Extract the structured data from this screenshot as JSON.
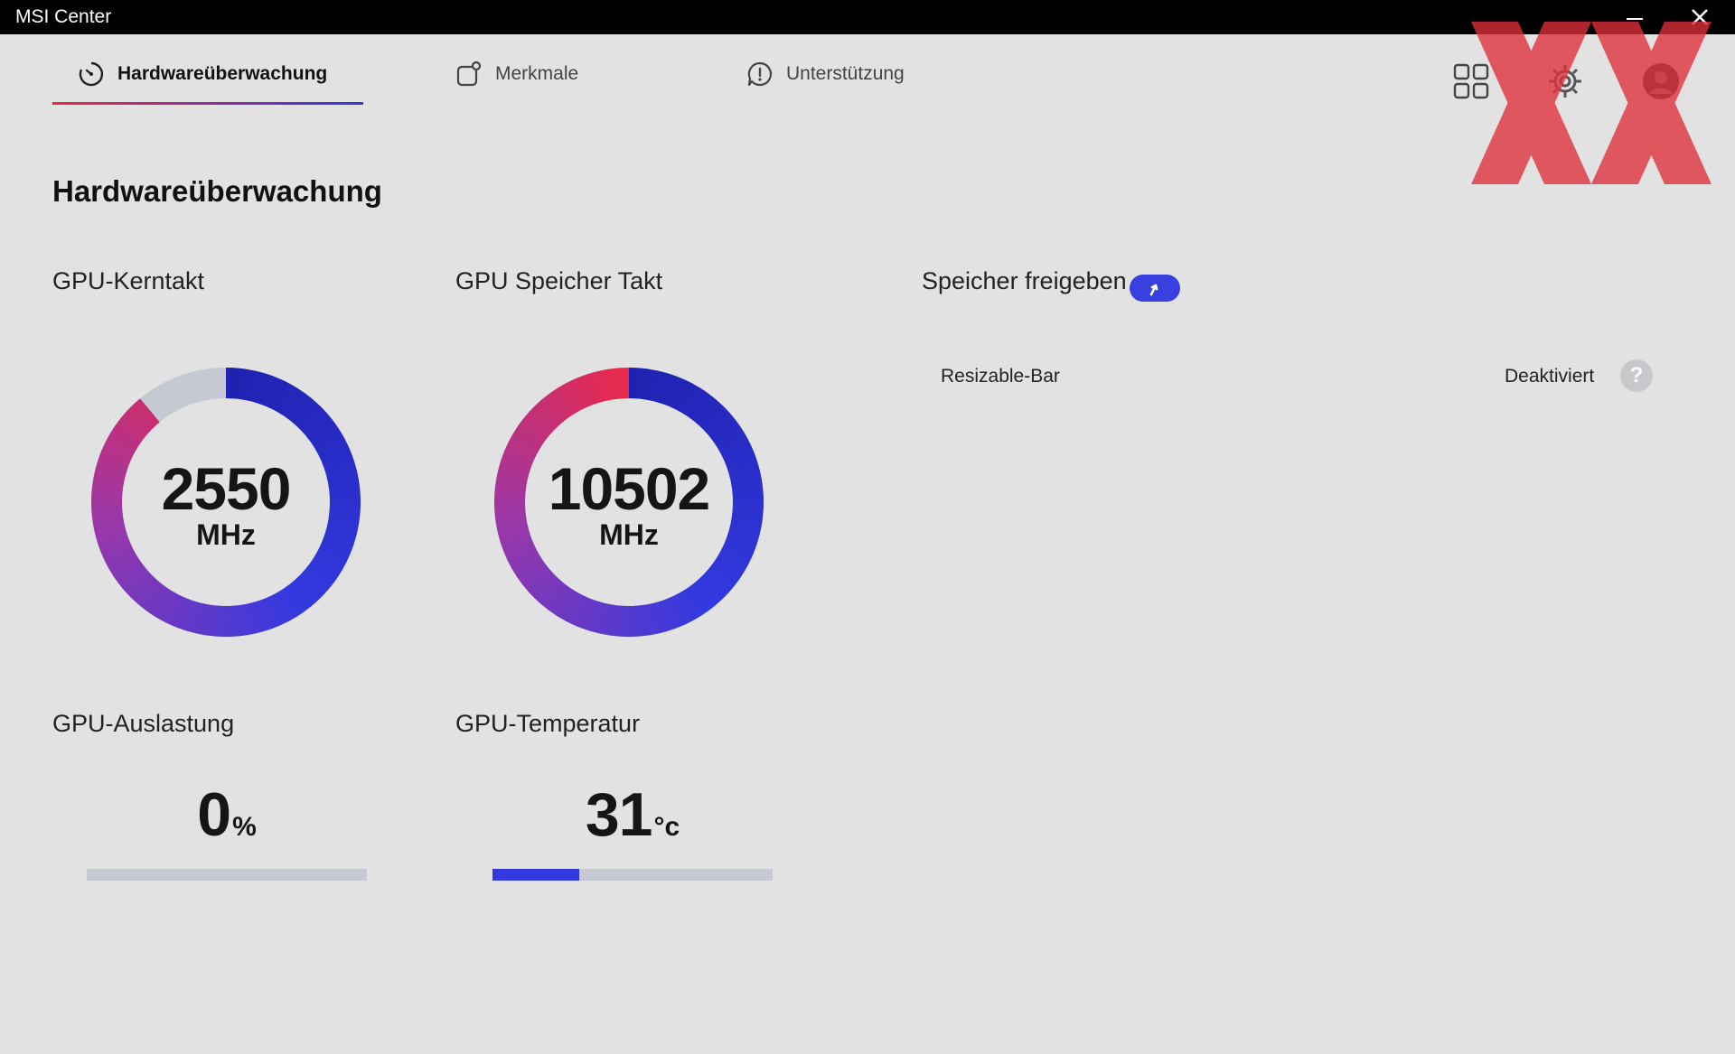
{
  "window": {
    "title": "MSI Center"
  },
  "tabs": [
    {
      "label": "Hardwareüberwachung",
      "icon": "gauge-icon",
      "active": true
    },
    {
      "label": "Merkmale",
      "icon": "feature-icon",
      "active": false
    },
    {
      "label": "Unterstützung",
      "icon": "support-icon",
      "active": false
    }
  ],
  "top_icons": [
    "grid-icon",
    "settings-icon",
    "profile-icon"
  ],
  "page_title": "Hardwareüberwachung",
  "metrics": {
    "core_clock": {
      "label": "GPU-Kerntakt",
      "value": "2550",
      "unit": "MHz",
      "fraction": 0.89
    },
    "mem_clock": {
      "label": "GPU Speicher Takt",
      "value": "10502",
      "unit": "MHz",
      "fraction": 1.0
    },
    "usage": {
      "label": "GPU-Auslastung",
      "value": "0",
      "unit": "%",
      "fraction": 0.0
    },
    "temperature": {
      "label": "GPU-Temperatur",
      "value": "31",
      "unit": "°c",
      "fraction": 0.31
    }
  },
  "memory": {
    "label": "Speicher freigeben",
    "toggle_icon": "arrow-up-icon",
    "rows": [
      {
        "name": "Resizable-Bar",
        "status": "Deaktiviert",
        "help_icon": "question-icon",
        "help_glyph": "?"
      }
    ]
  },
  "colors": {
    "accent_blue": "#3339e0",
    "accent_red": "#e8294c",
    "dark_blue": "#1f22b0",
    "track": "#c6c9d2"
  }
}
